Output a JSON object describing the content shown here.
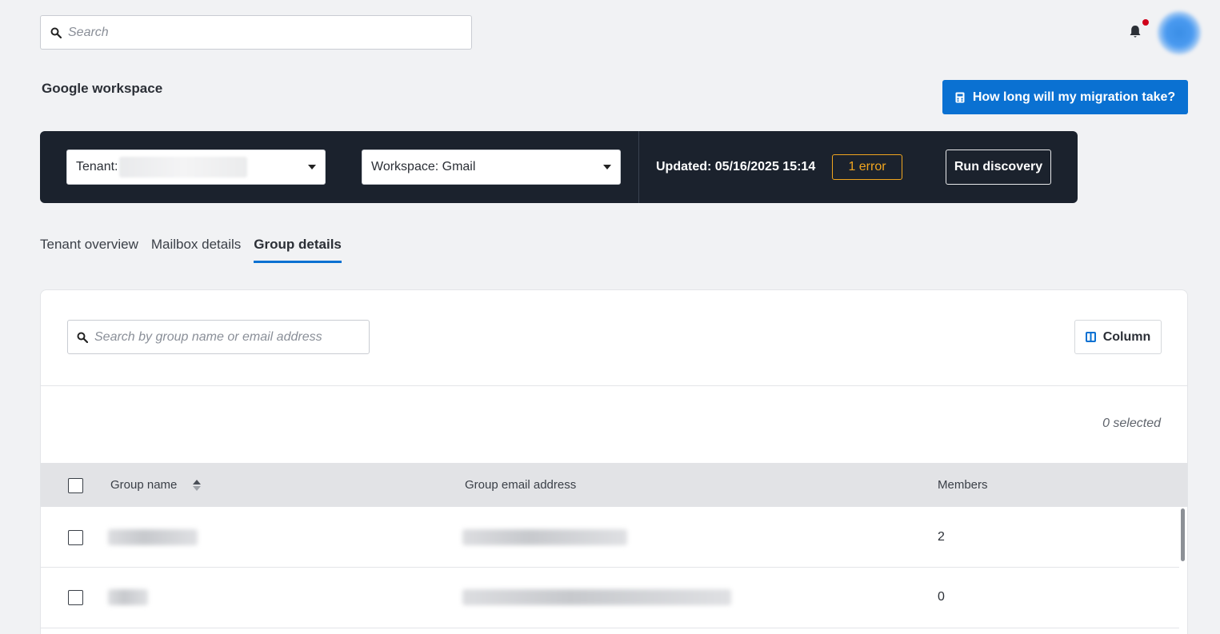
{
  "header": {
    "search_placeholder": "Search"
  },
  "page": {
    "title": "Google workspace",
    "estimate_button": "How long will my migration take?"
  },
  "banner": {
    "tenant_label": "Tenant:",
    "workspace_label": "Workspace: Gmail",
    "updated": "Updated: 05/16/2025 15:14",
    "error_badge": "1 error",
    "run_button": "Run discovery"
  },
  "tabs": [
    {
      "label": "Tenant overview",
      "active": false
    },
    {
      "label": "Mailbox details",
      "active": false
    },
    {
      "label": "Group details",
      "active": true
    }
  ],
  "table_controls": {
    "search_placeholder": "Search by group name or email address",
    "column_button": "Column",
    "selected_count": "0 selected"
  },
  "table": {
    "columns": [
      "Group name",
      "Group email address",
      "Members"
    ],
    "rows": [
      {
        "members": "2"
      },
      {
        "members": "0"
      }
    ]
  },
  "colors": {
    "accent": "#0a71d2",
    "banner_bg": "#1b222d",
    "error": "#f0a51f",
    "notification_dot": "#d0021b"
  }
}
